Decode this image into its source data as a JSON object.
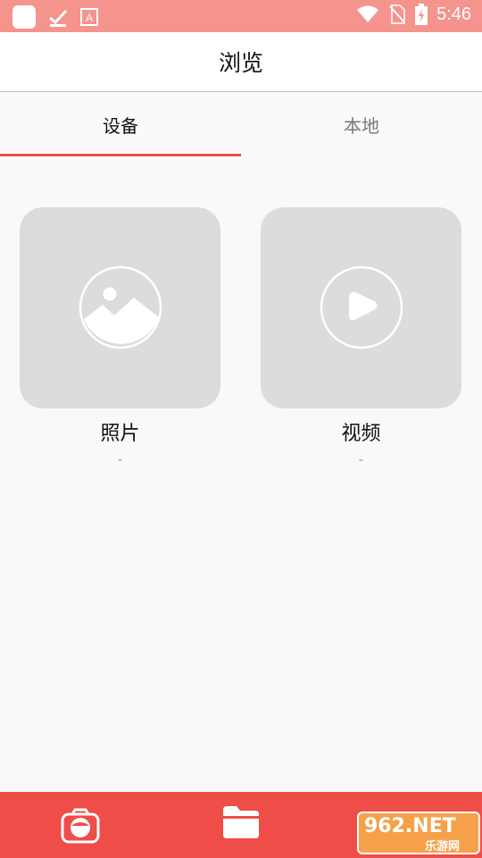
{
  "status_bar": {
    "time": "5:46"
  },
  "header": {
    "title": "浏览"
  },
  "tabs": [
    {
      "label": "设备",
      "active": true
    },
    {
      "label": "本地",
      "active": false
    }
  ],
  "cards": [
    {
      "title": "照片",
      "count": "-",
      "icon": "image-icon"
    },
    {
      "title": "视频",
      "count": "-",
      "icon": "play-icon"
    }
  ],
  "bottom_nav": [
    {
      "icon": "camera-icon"
    },
    {
      "icon": "folder-icon"
    }
  ],
  "watermark": {
    "top": "962.NET",
    "bottom": "乐游网"
  },
  "colors": {
    "status_bar": "#f5938d",
    "accent": "#e8514b",
    "bottom_bar": "#ef4d47",
    "tile": "#dcdcdc"
  }
}
